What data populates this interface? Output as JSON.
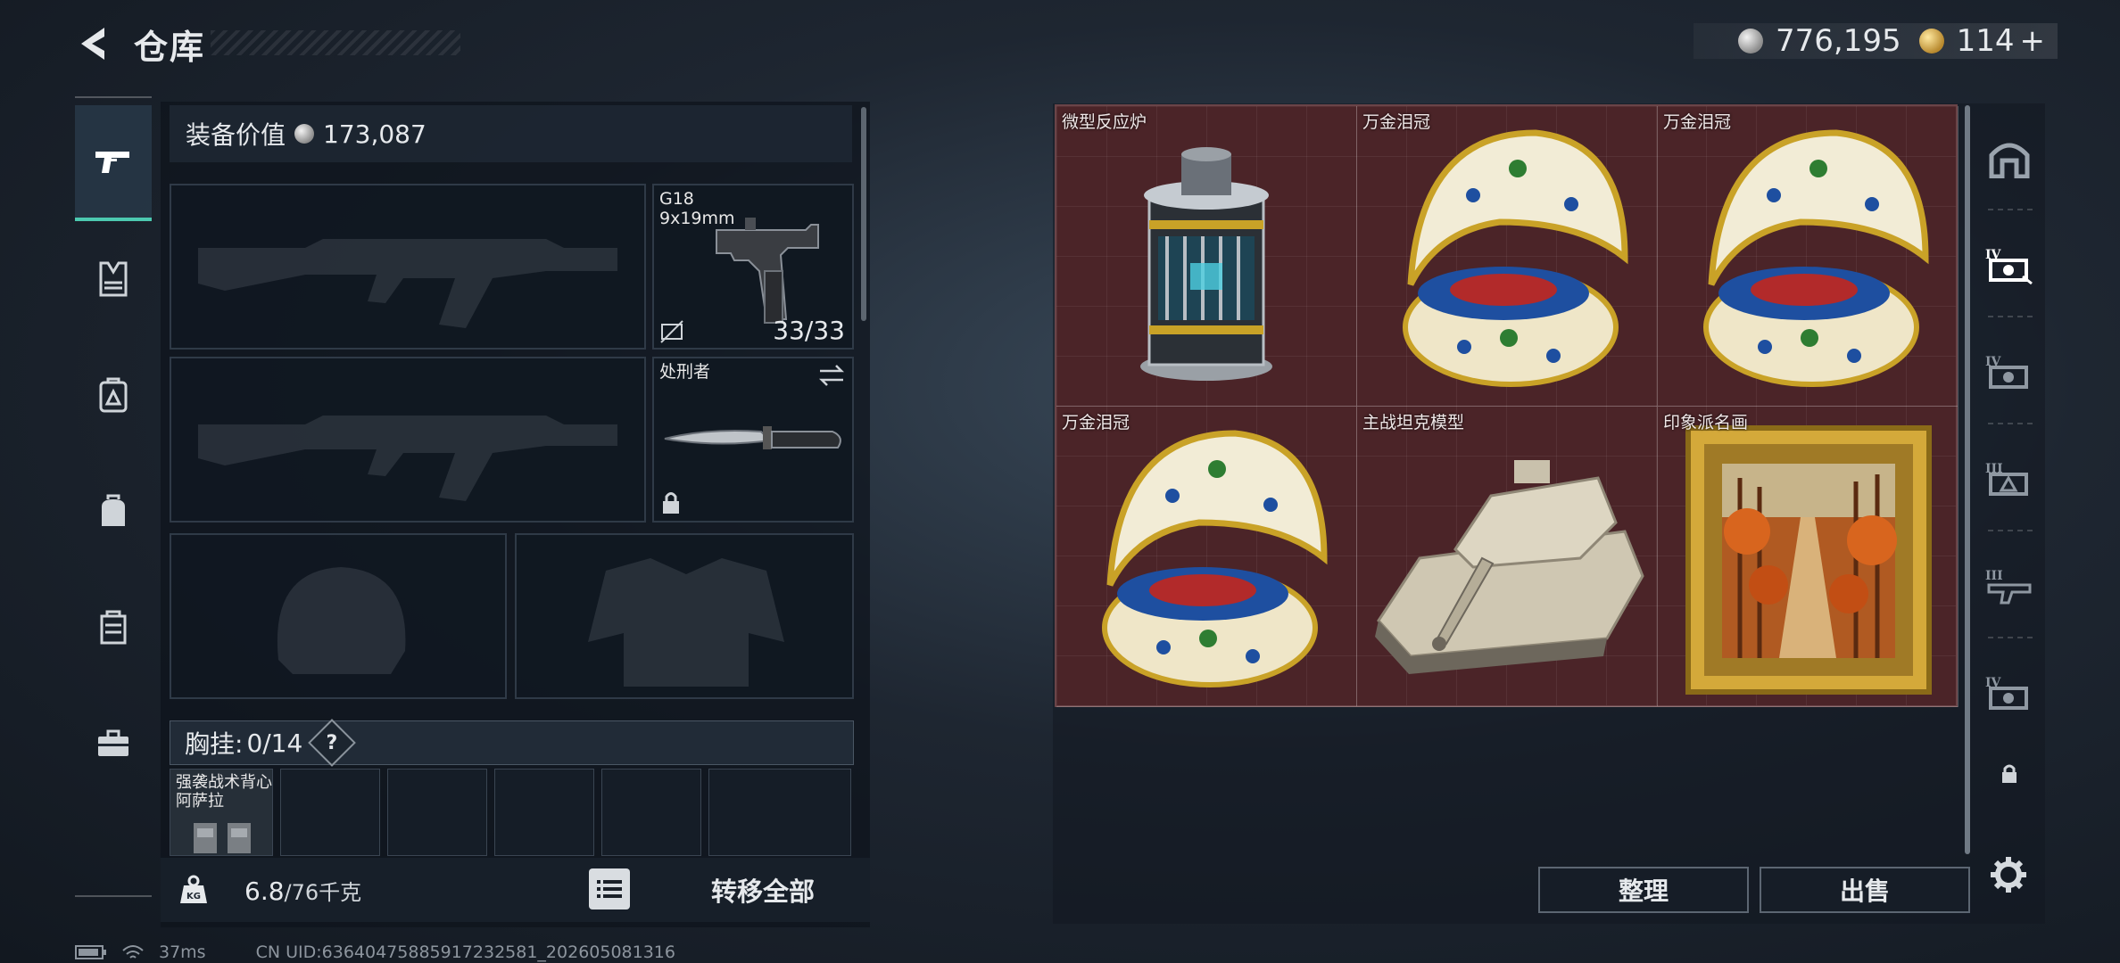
{
  "header": {
    "title": "仓库",
    "currencies": [
      {
        "icon": "silver-coin-icon",
        "value": "776,195"
      },
      {
        "icon": "gold-coin-icon",
        "value": "114"
      }
    ],
    "add_label": "+"
  },
  "left_categories": [
    {
      "icon": "pistol-icon",
      "active": true
    },
    {
      "icon": "armor-vest-icon",
      "active": false
    },
    {
      "icon": "loadout-pack-icon",
      "active": false
    },
    {
      "icon": "backpack-icon",
      "active": false
    },
    {
      "icon": "container-icon",
      "active": false
    },
    {
      "icon": "toolbox-icon",
      "active": false
    }
  ],
  "equipment": {
    "value_label": "装备价值",
    "value": "173,087",
    "pistol": {
      "name": "G18",
      "caliber": "9x19mm",
      "ammo": "33/33"
    },
    "melee": {
      "name": "处刑者"
    },
    "chest_rig_label": "胸挂:",
    "chest_rig_count": "0/14",
    "help_label": "?",
    "rig_item": {
      "name_line1": "强袭战术背心",
      "name_line2": "阿萨拉"
    },
    "weight_value": "6.8",
    "weight_max": "/76千克",
    "transfer_all": "转移全部"
  },
  "storage_items": [
    {
      "name": "微型反应炉",
      "icon": "micro-reactor-icon"
    },
    {
      "name": "万金泪冠",
      "icon": "jeweled-egg-icon"
    },
    {
      "name": "万金泪冠",
      "icon": "jeweled-egg-icon"
    },
    {
      "name": "万金泪冠",
      "icon": "jeweled-egg-icon"
    },
    {
      "name": "主战坦克模型",
      "icon": "tank-model-icon"
    },
    {
      "name": "印象派名画",
      "icon": "framed-painting-icon"
    }
  ],
  "right_categories": [
    {
      "icon": "storage-home-icon"
    },
    {
      "icon": "tier-4-stash-icon",
      "tier": "IV"
    },
    {
      "icon": "tier-4-stash-icon",
      "tier": "IV"
    },
    {
      "icon": "tier-3-stash-icon",
      "tier": "III"
    },
    {
      "icon": "tier-3-stash-icon",
      "tier": "III"
    },
    {
      "icon": "tier-4-stash-icon",
      "tier": "IV"
    },
    {
      "icon": "lock-icon"
    }
  ],
  "actions": {
    "sort": "整理",
    "sell": "出售"
  },
  "status": {
    "ping": "37ms",
    "uid": "CN UID:6364047588591723258​1_202605081316"
  }
}
